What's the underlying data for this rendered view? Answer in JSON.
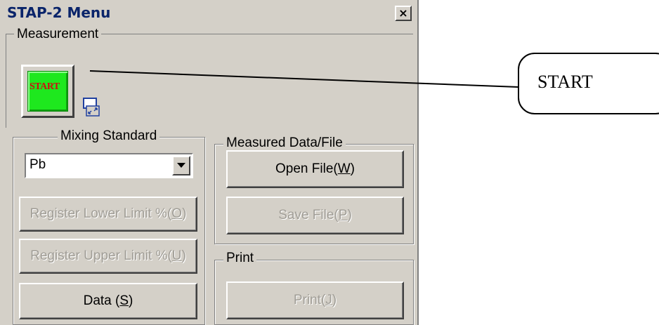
{
  "window": {
    "title": "STAP-2 Menu",
    "close_label": "×"
  },
  "measurement": {
    "group_label": "Measurement",
    "start_label": "START"
  },
  "mixing_standard": {
    "group_label": "Mixing Standard",
    "selected_value": "Pb",
    "register_lower": {
      "text": "Register Lower Limit %(",
      "key": "O",
      "tail": ")"
    },
    "register_upper": {
      "text": "Register Upper Limit %(",
      "key": "U",
      "tail": ")"
    },
    "data": {
      "text": "Data (",
      "key": "S",
      "tail": ")"
    }
  },
  "measured_data": {
    "group_label": "Measured Data/File",
    "open_file": {
      "text": "Open File(",
      "key": "W",
      "tail": ")"
    },
    "save_file": {
      "text": "Save File(",
      "key": "P",
      "tail": ")"
    }
  },
  "print": {
    "group_label": "Print",
    "print_btn": {
      "text": "Print(",
      "key": "J",
      "tail": ")"
    }
  },
  "callout": {
    "text": "START"
  },
  "colors": {
    "window_bg": "#d4d0c8",
    "start_green": "#1ee81e",
    "start_text": "#cc1111",
    "disabled_text": "#a09d96"
  }
}
